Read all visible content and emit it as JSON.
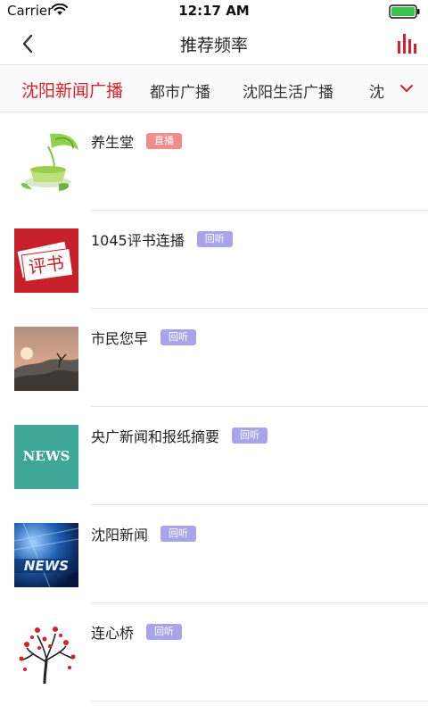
{
  "status_bar": {
    "carrier": "Carrier",
    "time": "12:17 AM"
  },
  "nav": {
    "title": "推荐频率",
    "back_icon": "chevron-left-icon",
    "menu_icon": "bar-chart-icon"
  },
  "colors": {
    "accent": "#d8212a",
    "live_badge": "#f08c8c",
    "replay_badge": "#a9a3ec"
  },
  "tabs": [
    {
      "label": "沈阳新闻广播",
      "active": true
    },
    {
      "label": "都市广播",
      "active": false
    },
    {
      "label": "沈阳生活广播",
      "active": false
    },
    {
      "label": "沈",
      "active": false
    }
  ],
  "tabs_expand_icon": "chevron-down-icon",
  "programs": [
    {
      "title": "养生堂",
      "badge": "直播",
      "badge_type": "live",
      "thumb": "green-tea-image"
    },
    {
      "title": "1045评书连播",
      "badge": "回听",
      "badge_type": "replay",
      "thumb": "pingshu-logo-image",
      "thumb_text": "评书"
    },
    {
      "title": "市民您早",
      "badge": "回听",
      "badge_type": "replay",
      "thumb": "sunrise-image"
    },
    {
      "title": "央广新闻和报纸摘要",
      "badge": "回听",
      "badge_type": "replay",
      "thumb": "news-logo-image",
      "thumb_text": "NEWS"
    },
    {
      "title": "沈阳新闻",
      "badge": "回听",
      "badge_type": "replay",
      "thumb": "news-studio-image",
      "thumb_text": "NEWS"
    },
    {
      "title": "连心桥",
      "badge": "回听",
      "badge_type": "replay",
      "thumb": "heart-tree-image"
    }
  ]
}
